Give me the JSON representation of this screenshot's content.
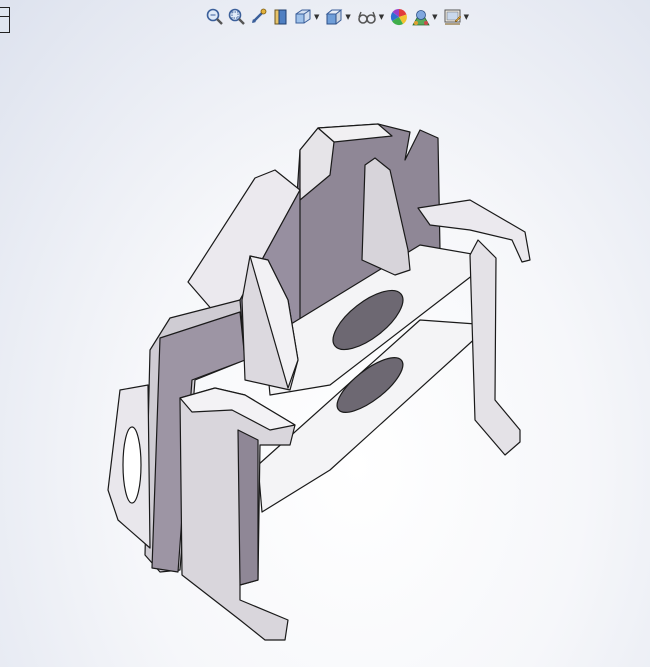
{
  "viewport": {
    "background_top": "#dde2ee",
    "background_center": "#ffffff",
    "model_fill": "#d8d6dc",
    "model_edge": "#1a1a1a",
    "model_shade": "#8c8690"
  },
  "toolbar": {
    "items": [
      {
        "icon": "zoom-to-fit-icon",
        "has_dropdown": false
      },
      {
        "icon": "zoom-to-area-icon",
        "has_dropdown": false
      },
      {
        "icon": "previous-view-icon",
        "has_dropdown": false
      },
      {
        "icon": "section-view-icon",
        "has_dropdown": false
      },
      {
        "icon": "view-orientation-icon",
        "has_dropdown": true
      },
      {
        "icon": "display-style-icon",
        "has_dropdown": true
      },
      {
        "icon": "hide-show-items-icon",
        "has_dropdown": true
      },
      {
        "icon": "edit-appearance-icon",
        "has_dropdown": false
      },
      {
        "icon": "apply-scene-icon",
        "has_dropdown": true
      },
      {
        "icon": "view-settings-icon",
        "has_dropdown": true
      }
    ]
  }
}
